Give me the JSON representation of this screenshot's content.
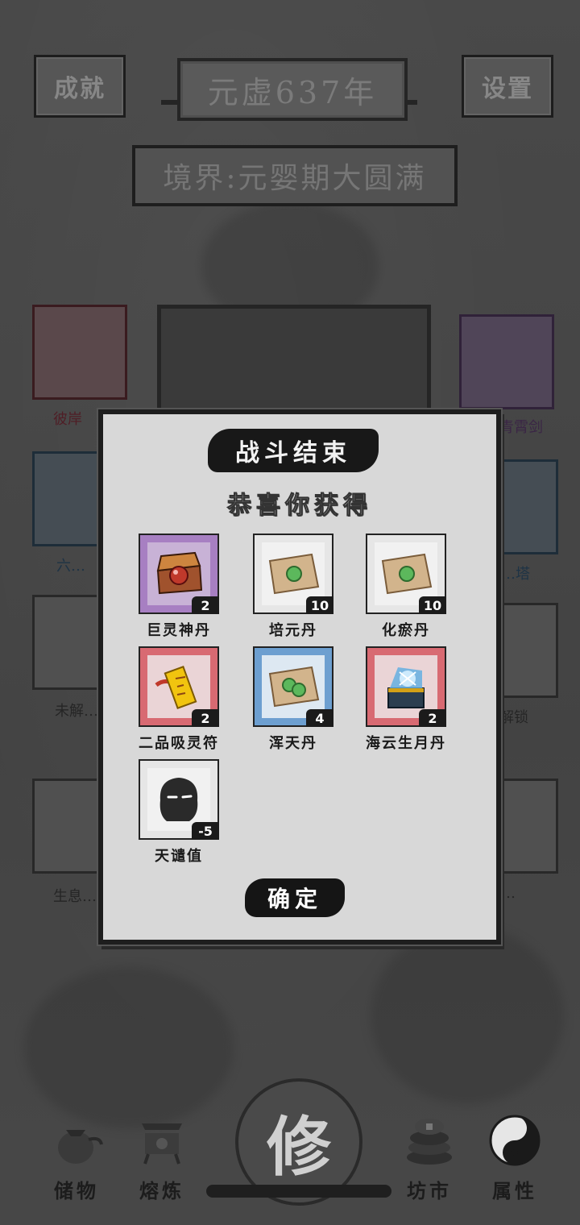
{
  "header": {
    "achievements_label": "成就",
    "year_label": "元虚637年",
    "settings_label": "设置",
    "realm_label": "境界:元婴期大圆满"
  },
  "background_items": [
    {
      "label": "彼岸",
      "color": "red"
    },
    {
      "label": "青霄剑",
      "color": "purple"
    },
    {
      "label": "六…",
      "color": "blue"
    },
    {
      "label": "…塔",
      "color": "blue"
    },
    {
      "label": "未解…",
      "color": "plain"
    },
    {
      "label": "解锁",
      "color": "plain"
    },
    {
      "label": "生息…",
      "color": "plain"
    },
    {
      "label": "…",
      "color": "plain"
    }
  ],
  "modal": {
    "title": "战斗结束",
    "subtitle": "恭喜你获得",
    "confirm_label": "确定",
    "rewards": [
      {
        "name": "巨灵神丹",
        "count": "2",
        "frame": "purple",
        "icon": "treasure-box-icon"
      },
      {
        "name": "培元丹",
        "count": "10",
        "frame": "white",
        "icon": "single-pill-icon"
      },
      {
        "name": "化瘀丹",
        "count": "10",
        "frame": "white",
        "icon": "single-pill-icon"
      },
      {
        "name": "二品吸灵符",
        "count": "2",
        "frame": "red",
        "icon": "talisman-icon"
      },
      {
        "name": "浑天丹",
        "count": "4",
        "frame": "blue",
        "icon": "double-pill-icon"
      },
      {
        "name": "海云生月丹",
        "count": "2",
        "frame": "red",
        "icon": "glowing-chest-icon"
      },
      {
        "name": "天谴值",
        "count": "-5",
        "frame": "white",
        "icon": "shadow-face-icon"
      }
    ]
  },
  "nav": {
    "storage_label": "储物",
    "smelt_label": "熔炼",
    "cultivate_label": "修",
    "market_label": "坊市",
    "attributes_label": "属性"
  }
}
